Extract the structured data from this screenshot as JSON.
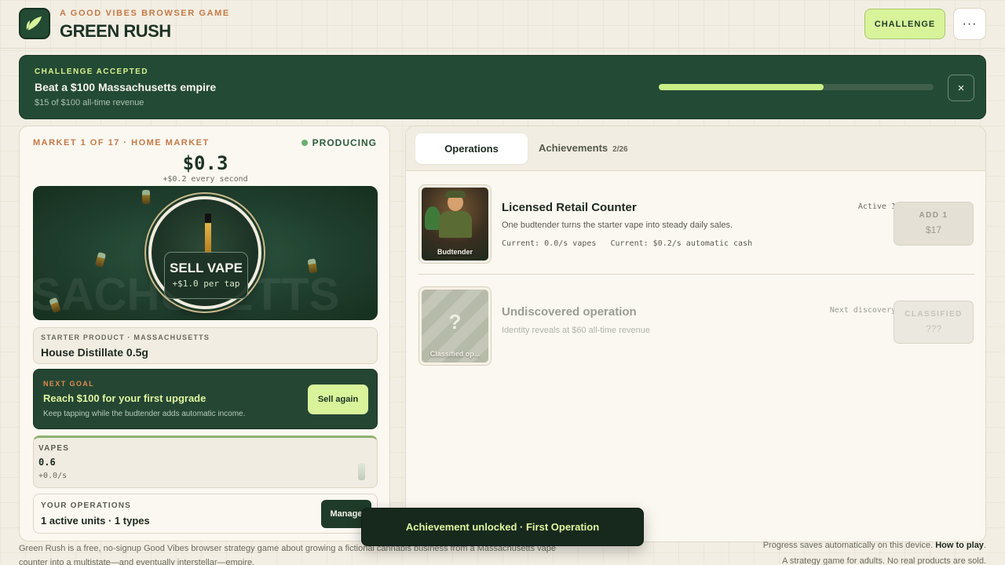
{
  "header": {
    "subtitle": "A GOOD VIBES BROWSER GAME",
    "title": "GREEN RUSH",
    "challenge_label": "CHALLENGE",
    "more_label": "···",
    "logo_icon": "leaf-icon"
  },
  "banner": {
    "kicker": "CHALLENGE ACCEPTED",
    "title": "Beat a $100 Massachusetts empire",
    "subtitle": "$15 of $100 all-time revenue",
    "progress": 0.6,
    "close_label": "×"
  },
  "market": {
    "label": "MARKET 1 OF 17 · HOME MARKET",
    "status": "PRODUCING",
    "cash": "$0.3",
    "rate": "+$0.2 every second",
    "bg_text": "SACHUSETTS",
    "sell_label": "SELL VAPE",
    "sell_sub": "+$1.0 per tap"
  },
  "product": {
    "kicker": "STARTER PRODUCT · MASSACHUSETTS",
    "name": "House Distillate 0.5g"
  },
  "goal": {
    "kicker": "NEXT GOAL",
    "title": "Reach $100 for your first upgrade",
    "subtitle": "Keep tapping while the budtender adds automatic income.",
    "button": "Sell again"
  },
  "vapes": {
    "kicker": "VAPES",
    "value": "0.6",
    "rate": "+0.0/s"
  },
  "your_ops": {
    "kicker": "YOUR OPERATIONS",
    "value": "1 active units · 1 types",
    "button": "Manage"
  },
  "tabs": {
    "operations": "Operations",
    "achievements": "Achievements",
    "achievements_count": "2/26"
  },
  "operations": [
    {
      "name": "Licensed Retail Counter",
      "description": "One budtender turns the starter vape into steady daily sales.",
      "stats": "Current: 0.0/s vapes   Current: $0.2/s automatic cash",
      "status": "Active 1",
      "thumb_label": "Budtender",
      "button_top": "ADD 1",
      "button_bottom": "$17"
    },
    {
      "name": "Undiscovered operation",
      "description": "Identity reveals at $60 all-time revenue",
      "status": "Next discovery",
      "thumb_label": "Classified op...",
      "thumb_symbol": "?",
      "button_top": "CLASSIFIED",
      "button_bottom": "???"
    }
  ],
  "footer": {
    "left": "Green Rush is a free, no-signup Good Vibes browser strategy game about growing a fictional cannabis business from a Massachusetts vape counter into a multistate—and eventually interstellar—empire.",
    "right_text": "Progress saves automatically on this device.",
    "right_link": "How to play",
    "right_line2": "A strategy game for adults. No real products are sold."
  },
  "toast": "Achievement unlocked · First Operation",
  "colors": {
    "brand_dark": "#234a35",
    "accent_lime": "#d9f39b",
    "accent_orange": "#c47a48",
    "background": "#f3eee3"
  }
}
